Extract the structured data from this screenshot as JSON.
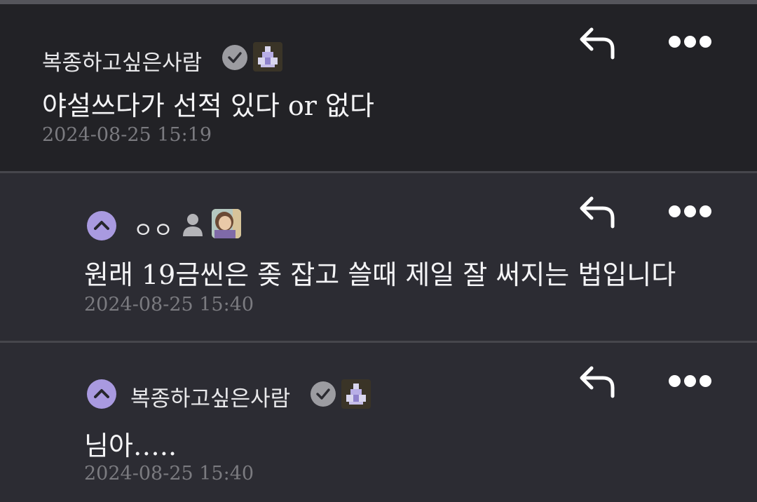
{
  "comments": [
    {
      "author": "복종하고싶은사람",
      "text": "야설쓰다가 선적 있다 or 없다",
      "timestamp": "2024-08-25 15:19"
    },
    {
      "author": "ㅇㅇ",
      "text": "원래 19금씬은 좆 잡고 쓸때 제일 잘 써지는 법입니다",
      "timestamp": "2024-08-25 15:40"
    },
    {
      "author": "복종하고싶은사람",
      "text": "님아…..",
      "timestamp": "2024-08-25 15:40"
    }
  ],
  "icons": {
    "reply": "reply-arrow-icon",
    "more": "more-horizontal-icon",
    "verified": "verified-check-icon",
    "collapse": "chevron-up-icon",
    "user": "user-silhouette-icon"
  },
  "colors": {
    "background": "#2b2b31",
    "top_comment_bg": "#222226",
    "accent": "#a99ae0",
    "timestamp": "#7b7b80"
  }
}
